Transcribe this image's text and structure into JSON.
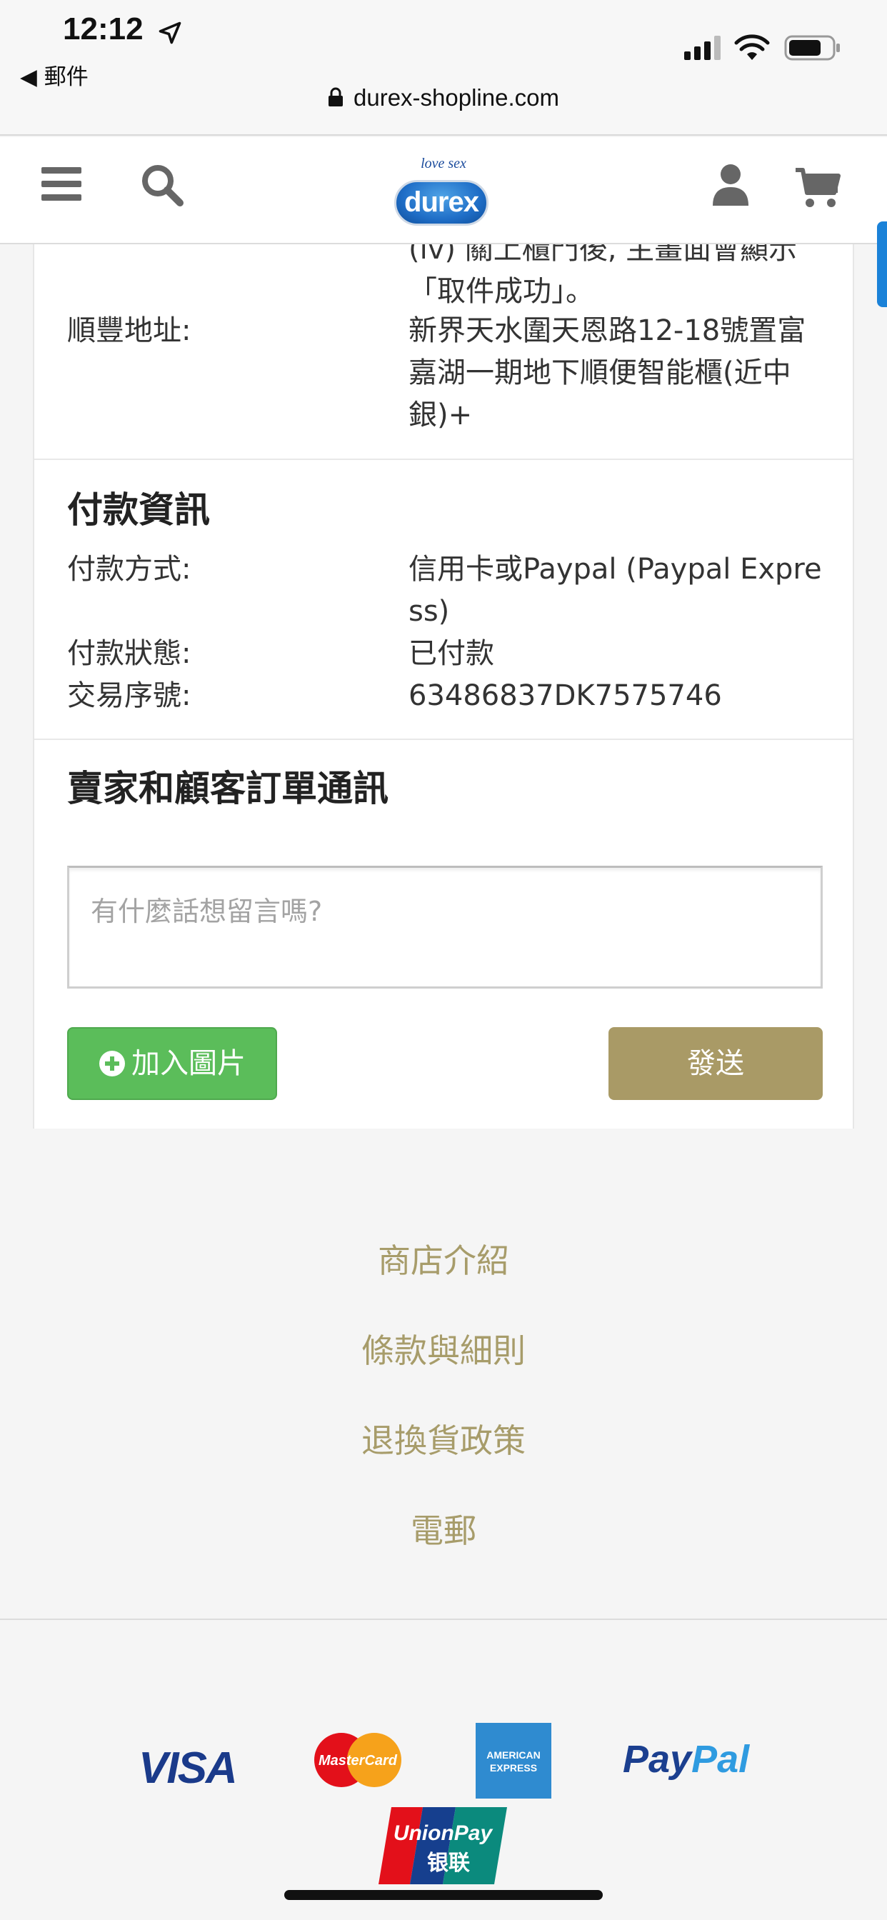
{
  "status_bar": {
    "time": "12:12",
    "back_app": "◀ 郵件",
    "url": "durex-shopline.com"
  },
  "header": {
    "logo_tagline": "love sex",
    "logo_text": "durex"
  },
  "pickup": {
    "cut_text_line1": "(iv) 關上櫃門後, 主畫面會顯示",
    "cut_text_line2": "「取件成功」。",
    "address_label": "順豐地址:",
    "address_value": "新界天水圍天恩路12-18號置富嘉湖一期地下順便智能櫃(近中銀)+"
  },
  "payment": {
    "title": "付款資訊",
    "method_label": "付款方式:",
    "method_value": "信用卡或Paypal (Paypal Express)",
    "status_label": "付款狀態:",
    "status_value": "已付款",
    "txn_label": "交易序號:",
    "txn_value": "63486837DK7575746"
  },
  "messages": {
    "title": "賣家和顧客訂單通訊",
    "placeholder": "有什麼話想留言嗎?",
    "add_image_label": "加入圖片",
    "send_label": "發送"
  },
  "footer": {
    "links": [
      "商店介紹",
      "條款與細則",
      "退換貨政策",
      "電郵"
    ]
  },
  "payment_logos": {
    "visa": "VISA",
    "mastercard": "MasterCard",
    "amex": "AMERICAN EXPRESS",
    "paypal_part1": "Pay",
    "paypal_part2": "Pal",
    "unionpay": "UnionPay",
    "unionpay_cn": "银联"
  },
  "colors": {
    "accent_gold": "#a79c6a",
    "send_button": "#a99a66",
    "add_image_button": "#5bbd5a",
    "brand_blue": "#1f6ec7"
  }
}
